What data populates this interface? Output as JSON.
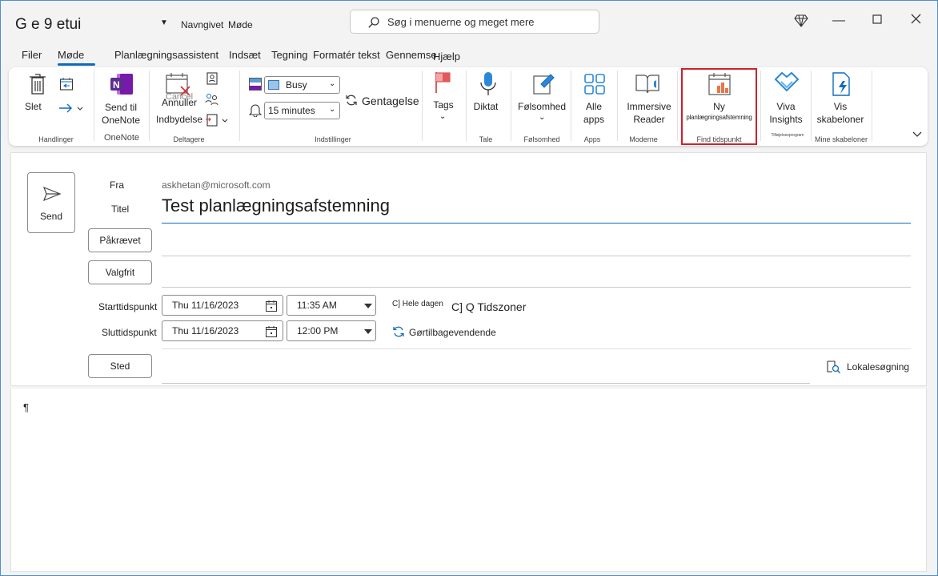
{
  "window": {
    "title": "G e 9 etui",
    "qat_named": "Navngivet",
    "qat_meeting": "Møde",
    "search_placeholder": "Søg i menuerne og meget mere"
  },
  "menu_tabs": [
    "Filer",
    "Møde",
    "Planlægningsassistent",
    "Indsæt",
    "Tegning",
    "Formatér tekst",
    "Gennemse",
    "Hjælp"
  ],
  "ribbon": {
    "delete": "Slet",
    "group_actions": "Handlinger",
    "send_onenote_1": "Send til",
    "send_onenote_2": "OneNote",
    "group_onenote": "OneNote",
    "cancel_1": "Annuller",
    "cancel_ghost": "Cancel",
    "cancel_2": "Indbydelse",
    "group_attendees": "Deltagere",
    "show_as": "Busy",
    "reminder": "15 minutes",
    "recurrence": "Gentagelse",
    "group_options": "Indstillinger",
    "tags": "Tags",
    "dictate": "Diktat",
    "group_voice": "Tale",
    "sensitivity": "Følsomhed",
    "group_sensitivity": "Følsomhed",
    "all_apps_1": "Alle",
    "all_apps_2": "apps",
    "group_apps": "Apps",
    "immersive_1": "Immersive",
    "immersive_2": "Reader",
    "group_immersive": "Moderne",
    "new_poll_1": "Ny",
    "new_poll_2": "planlægningsafstemning",
    "group_find_time": "Find tidspunkt",
    "viva_1": "Viva",
    "viva_2": "Insights",
    "group_addin": "Tilføjelsesprogram",
    "templates_1": "Vis",
    "templates_2": "skabeloner",
    "group_templates": "Mine skabeloner"
  },
  "form": {
    "send": "Send",
    "from_label": "Fra",
    "from_value": "askhetan@microsoft.com",
    "title_label": "Titel",
    "title_value": "Test planlægningsafstemning",
    "required": "Påkrævet",
    "optional": "Valgfrit",
    "start_label": "Starttidspunkt",
    "start_date": "Thu 11/16/2023",
    "start_time": "11:35 AM",
    "end_label": "Sluttidspunkt",
    "end_date": "Thu 11/16/2023",
    "end_time": "12:00 PM",
    "all_day": "C] Hele dagen",
    "time_zones": "C] Q Tidszoner",
    "recurring": "Gørtilbagevendende",
    "location_btn": "Sted",
    "room_finder": "Lokalesøgning"
  },
  "body": {
    "pilcrow": "¶"
  }
}
